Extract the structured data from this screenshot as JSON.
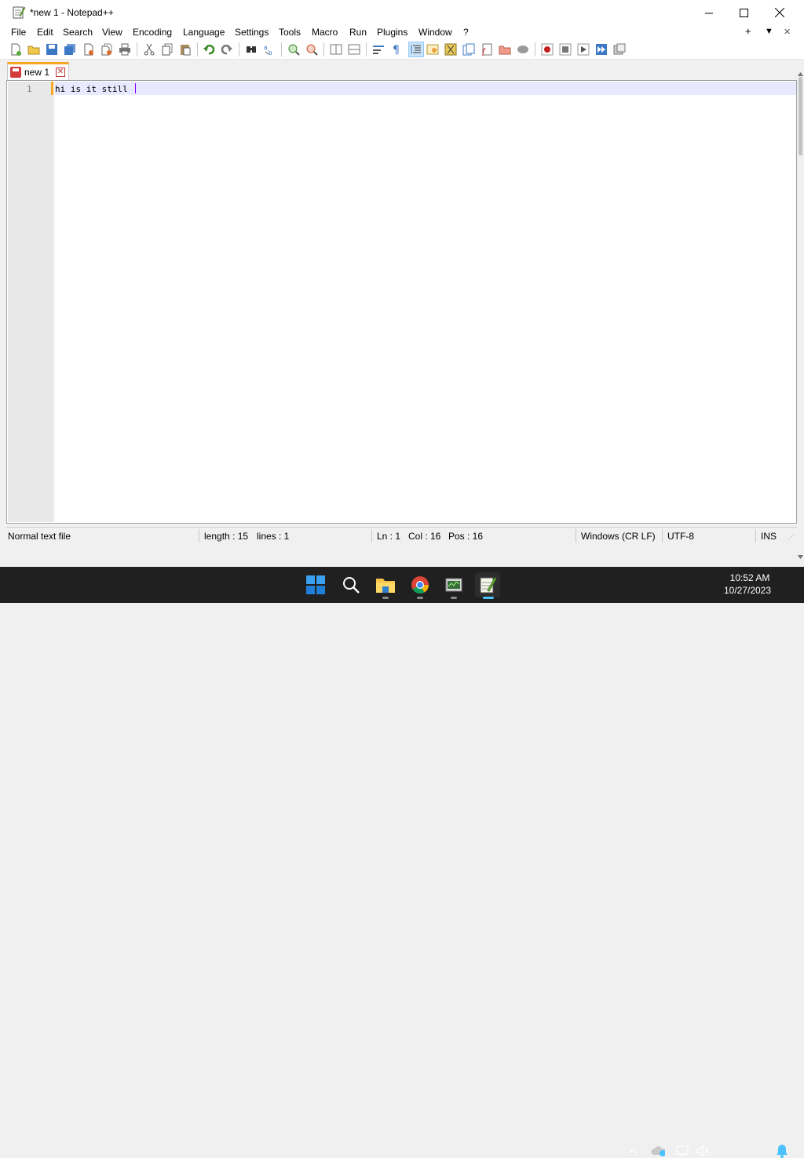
{
  "window": {
    "title": "*new 1 - Notepad++",
    "minimize_label": "—",
    "maximize_label": "□",
    "close_label": "✕"
  },
  "menu": [
    "File",
    "Edit",
    "Search",
    "View",
    "Encoding",
    "Language",
    "Settings",
    "Tools",
    "Macro",
    "Run",
    "Plugins",
    "Window",
    "?"
  ],
  "menu_right": {
    "add": "+",
    "dropdown": "▼",
    "close": "✕"
  },
  "toolbar": {
    "icons": [
      "new-file-icon",
      "open-file-icon",
      "save-icon",
      "save-all-icon",
      "close-icon",
      "close-all-icon",
      "print-icon",
      "cut-icon",
      "copy-icon",
      "paste-icon",
      "undo-icon",
      "redo-icon",
      "find-icon",
      "replace-icon",
      "zoom-in-icon",
      "zoom-out-icon",
      "sync-vertical-icon",
      "sync-horizontal-icon",
      "word-wrap-icon",
      "show-all-characters-icon",
      "indent-guide-icon",
      "user-language-icon",
      "document-map-icon",
      "function-list-icon",
      "folder-as-workspace-icon",
      "document-list-icon",
      "monitoring-icon",
      "record-macro-icon",
      "stop-macro-icon",
      "play-macro-icon",
      "run-macro-multiple-icon",
      "save-macro-icon"
    ]
  },
  "tab": {
    "label": "new 1",
    "close": "✕"
  },
  "editor": {
    "line_number": "1",
    "text": "hi is it still "
  },
  "status": {
    "file_type": "Normal text file",
    "length": "length : 15",
    "lines": "lines : 1",
    "ln": "Ln : 1",
    "col": "Col : 16",
    "pos": "Pos : 16",
    "eol": "Windows (CR LF)",
    "encoding": "UTF-8",
    "mode": "INS"
  },
  "taskbar": {
    "apps": [
      "start-icon",
      "search-icon",
      "file-explorer-icon",
      "chrome-icon",
      "task-manager-icon",
      "notepadpp-icon"
    ],
    "time": "10:52 AM",
    "date": "10/27/2023"
  },
  "colors": {
    "accent": "#f5a623",
    "caret": "#8000ff",
    "current_line": "#e8e8ff",
    "taskbar": "#202020"
  }
}
